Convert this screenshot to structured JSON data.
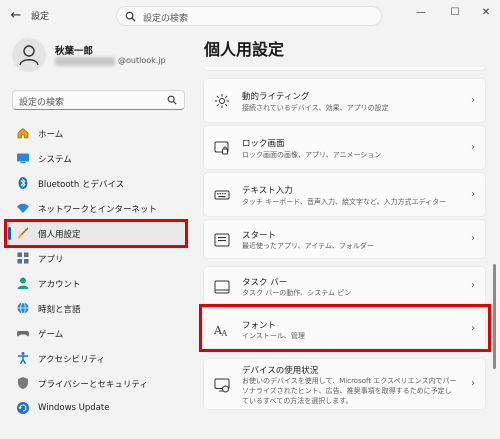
{
  "window": {
    "title": "設定"
  },
  "search": {
    "top_placeholder": "設定の検索",
    "side_placeholder": "設定の検索"
  },
  "user": {
    "name": "秋葉一郎",
    "email_visible": "@outlook.jp"
  },
  "sidebar": {
    "items": [
      {
        "label": "ホーム",
        "icon": "home-icon"
      },
      {
        "label": "システム",
        "icon": "system-icon"
      },
      {
        "label": "Bluetooth とデバイス",
        "icon": "bluetooth-icon"
      },
      {
        "label": "ネットワークとインターネット",
        "icon": "wifi-icon"
      },
      {
        "label": "個人用設定",
        "icon": "brush-icon",
        "selected": true
      },
      {
        "label": "アプリ",
        "icon": "apps-icon"
      },
      {
        "label": "アカウント",
        "icon": "account-icon"
      },
      {
        "label": "時刻と言語",
        "icon": "globe-icon"
      },
      {
        "label": "ゲーム",
        "icon": "gamepad-icon"
      },
      {
        "label": "アクセシビリティ",
        "icon": "accessibility-icon"
      },
      {
        "label": "プライバシーとセキュリティ",
        "icon": "shield-icon"
      },
      {
        "label": "Windows Update",
        "icon": "update-icon"
      }
    ]
  },
  "main": {
    "title": "個人用設定",
    "cards": [
      {
        "title": "動的ライティング",
        "subtitle": "接続されているデバイス、効果、アプリの設定",
        "icon": "dynamic-lighting-icon"
      },
      {
        "title": "ロック画面",
        "subtitle": "ロック画面の画像、アプリ、アニメーション",
        "icon": "lock-screen-icon"
      },
      {
        "title": "テキスト入力",
        "subtitle": "タッチ キーボード、音声入力、絵文字など、入力方式エディター",
        "icon": "keyboard-icon"
      },
      {
        "title": "スタート",
        "subtitle": "最近使ったアプリ、アイテム、フォルダー",
        "icon": "start-icon"
      },
      {
        "title": "タスク バー",
        "subtitle": "タスク バーの動作、システム ピン",
        "icon": "taskbar-icon"
      },
      {
        "title": "フォント",
        "subtitle": "インストール、管理",
        "icon": "fonts-icon"
      },
      {
        "title": "デバイスの使用状況",
        "subtitle": "お使いのデバイスを使用して、Microsoft エクスペリエンス内でパーソナライズされたヒント、広告、推奨事項を取得するために予定しているすべての方法を選択します。",
        "icon": "device-usage-icon"
      }
    ]
  },
  "colors": {
    "accent": "#0067c0",
    "highlight": "#e00000"
  }
}
